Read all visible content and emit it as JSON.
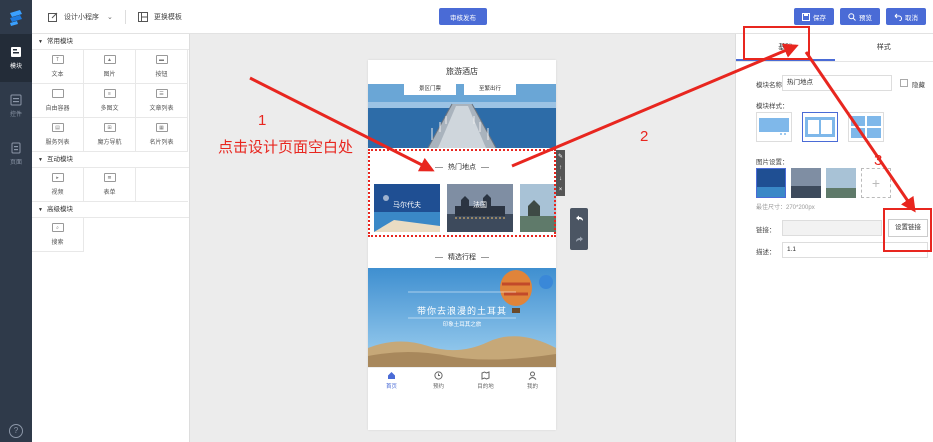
{
  "topbar": {
    "design_label": "设计小程序",
    "template_label": "更换模板",
    "publish_label": "审核发布",
    "save_label": "保存",
    "preview_label": "预览",
    "cancel_label": "取消"
  },
  "rail": {
    "items": [
      {
        "label": "模块",
        "icon": "module-icon"
      },
      {
        "label": "控件",
        "icon": "widget-icon"
      },
      {
        "label": "页面",
        "icon": "page-icon"
      }
    ],
    "help": "?"
  },
  "components": {
    "sections": [
      {
        "title": "常用模块",
        "items": [
          {
            "label": "文本",
            "glyph": "T"
          },
          {
            "label": "图片",
            "glyph": "▲"
          },
          {
            "label": "按钮",
            "glyph": "▬"
          },
          {
            "label": "自由容器",
            "glyph": ""
          },
          {
            "label": "多图文",
            "glyph": "≡"
          },
          {
            "label": "文章列表",
            "glyph": "☰"
          },
          {
            "label": "服务列表",
            "glyph": "▤"
          },
          {
            "label": "魔方导航",
            "glyph": "⊞"
          },
          {
            "label": "名片列表",
            "glyph": "▦"
          }
        ]
      },
      {
        "title": "互动模块",
        "items": [
          {
            "label": "视频",
            "glyph": "▸"
          },
          {
            "label": "表单",
            "glyph": "≣"
          }
        ]
      },
      {
        "title": "高级模块",
        "items": [
          {
            "label": "搜索",
            "glyph": "⌕"
          }
        ]
      }
    ]
  },
  "phone": {
    "title": "旅游酒店",
    "pills": [
      "景区门票",
      "至繁出行"
    ],
    "hot_title": "热门地点",
    "photos": [
      "马尔代夫",
      "法国",
      ""
    ],
    "itinerary_title": "精选行程",
    "banner_text": "带你去浪漫的土耳其",
    "banner_sub": "印象土耳其之旅",
    "tabs": [
      {
        "label": "首页",
        "icon": "home-icon"
      },
      {
        "label": "预约",
        "icon": "clock-icon"
      },
      {
        "label": "目的地",
        "icon": "map-icon"
      },
      {
        "label": "我的",
        "icon": "user-icon"
      }
    ]
  },
  "props": {
    "tabs": [
      "基础",
      "样式"
    ],
    "name_label": "模块名称：",
    "name_value": "热门地点",
    "hide_label": "隐藏",
    "style_label": "模块样式：",
    "image_label": "图片设置：",
    "size_hint": "最佳尺寸：270*200px",
    "link_label": "链接：",
    "link_button": "设置链接",
    "desc_label": "描述：",
    "desc_value": "1.1"
  },
  "annotations": {
    "step1": "1",
    "step1_text": "点击设计页面空白处",
    "step2": "2",
    "step3": "3"
  },
  "colors": {
    "accent": "#4a6bd6",
    "annotation": "#e8261f",
    "rail": "#2f3a4a"
  }
}
